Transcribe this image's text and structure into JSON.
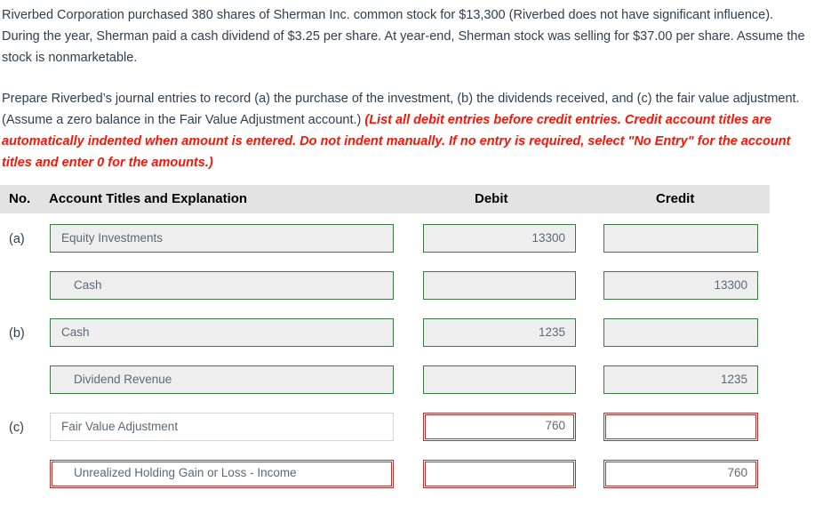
{
  "problem": {
    "paragraph_1": "Riverbed Corporation purchased 380 shares of Sherman Inc. common stock for $13,300 (Riverbed does not have significant influence). During the year, Sherman paid a cash dividend of $3.25 per share. At year-end, Sherman stock was selling for $37.00 per share. Assume the stock is nonmarketable.",
    "paragraph_2_lead": "Prepare Riverbed’s journal entries to record (a) the purchase of the investment, (b) the dividends received, and (c) the fair value adjustment. (Assume a zero balance in the Fair Value Adjustment account.) ",
    "paragraph_2_hint": "(List all debit entries before credit entries. Credit account titles are automatically indented when amount is entered. Do not indent manually. If no entry is required, select \"No Entry\" for the account titles and enter 0 for the amounts.)"
  },
  "table": {
    "headers": {
      "no": "No.",
      "account": "Account Titles and Explanation",
      "debit": "Debit",
      "credit": "Credit"
    },
    "rows": [
      {
        "label": "(a)",
        "account": "Equity Investments",
        "debit": "13300",
        "credit": "",
        "indent": false,
        "state": "filled"
      },
      {
        "label": "",
        "account": "Cash",
        "debit": "",
        "credit": "13300",
        "indent": true,
        "state": "filled"
      },
      {
        "label": "(b)",
        "account": "Cash",
        "debit": "1235",
        "credit": "",
        "indent": false,
        "state": "filled"
      },
      {
        "label": "",
        "account": "Dividend Revenue",
        "debit": "",
        "credit": "1235",
        "indent": true,
        "state": "filled"
      },
      {
        "label": "(c)",
        "account": "Fair Value Adjustment",
        "debit": "760",
        "credit": "",
        "indent": false,
        "state": "error",
        "account_state": "plain"
      },
      {
        "label": "",
        "account": "Unrealized Holding Gain or Loss - Income",
        "debit": "",
        "credit": "760",
        "indent": true,
        "state": "error",
        "account_state": "error"
      }
    ]
  },
  "colors": {
    "header_bg": "#e3e3e3",
    "field_border_ok": "#3d7a42",
    "field_border_error": "#b03530",
    "field_bg": "#eeeeee",
    "hint_text": "#fb1405",
    "body_text": "#2e3f50"
  }
}
